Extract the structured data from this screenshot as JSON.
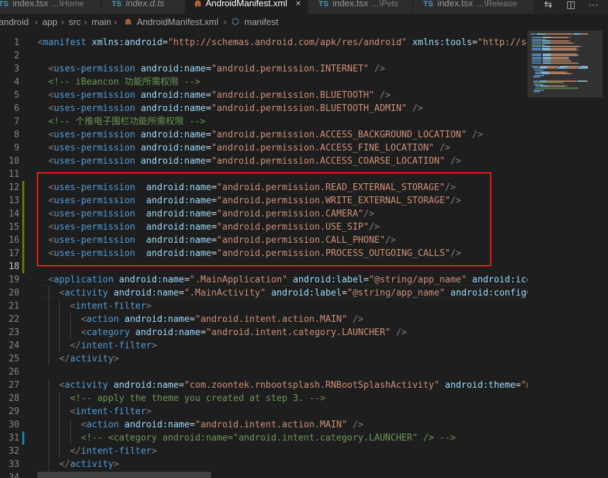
{
  "tabs": [
    {
      "name": "index.tsx",
      "desc": "...\\Home",
      "type": "ts",
      "italic": false,
      "active": false
    },
    {
      "name": "index.d.ts",
      "desc": "",
      "type": "ts",
      "italic": true,
      "active": false
    },
    {
      "name": "AndroidManifest.xml",
      "desc": "",
      "type": "xml",
      "italic": false,
      "active": true,
      "close": "×"
    },
    {
      "name": "index.tsx",
      "desc": "...\\Pets",
      "type": "ts",
      "italic": false,
      "active": false
    },
    {
      "name": "index.tsx",
      "desc": "...\\Release",
      "type": "ts",
      "italic": false,
      "active": false
    }
  ],
  "tab_actions": {
    "compare": "⇆",
    "split": "◫",
    "more": "···"
  },
  "breadcrumb": [
    "android",
    "app",
    "src",
    "main",
    "AndroidManifest.xml",
    "manifest"
  ],
  "ts_badge": "TS",
  "xml_badge": "⋒",
  "cube_icon": "⬡",
  "separator": "›",
  "colors": {
    "highlight_box": "#e51e1e",
    "added_line": "#587c0c",
    "modified_line": "#1b81a8"
  },
  "code_lines": [
    {
      "n": "1",
      "tokens": [
        [
          "<",
          "pn"
        ],
        [
          "manifest",
          "tg"
        ],
        [
          " xmlns:android",
          "at"
        ],
        [
          "=",
          "tx"
        ],
        [
          "\"http://schemas.android.com/apk/res/android\"",
          "st"
        ],
        [
          " xmlns:tools",
          "at"
        ],
        [
          "=",
          "tx"
        ],
        [
          "\"http://sch",
          "st"
        ]
      ]
    },
    {
      "n": "2",
      "tokens": []
    },
    {
      "n": "3",
      "tokens": [
        [
          "  <",
          "pn"
        ],
        [
          "uses-permission",
          "tg"
        ],
        [
          " android:name",
          "at"
        ],
        [
          "=",
          "tx"
        ],
        [
          "\"android.permission.INTERNET\"",
          "st"
        ],
        [
          " />",
          "pn"
        ]
      ]
    },
    {
      "n": "4",
      "tokens": [
        [
          "  <!-- iBeancon 功能所需权限 -->",
          "cm"
        ]
      ]
    },
    {
      "n": "5",
      "tokens": [
        [
          "  <",
          "pn"
        ],
        [
          "uses-permission",
          "tg"
        ],
        [
          " android:name",
          "at"
        ],
        [
          "=",
          "tx"
        ],
        [
          "\"android.permission.BLUETOOTH\"",
          "st"
        ],
        [
          " />",
          "pn"
        ]
      ]
    },
    {
      "n": "6",
      "tokens": [
        [
          "  <",
          "pn"
        ],
        [
          "uses-permission",
          "tg"
        ],
        [
          " android:name",
          "at"
        ],
        [
          "=",
          "tx"
        ],
        [
          "\"android.permission.BLUETOOTH_ADMIN\"",
          "st"
        ],
        [
          " />",
          "pn"
        ]
      ]
    },
    {
      "n": "7",
      "tokens": [
        [
          "  <!-- 个推电子围栏功能所需权限 -->",
          "cm"
        ]
      ]
    },
    {
      "n": "8",
      "tokens": [
        [
          "  <",
          "pn"
        ],
        [
          "uses-permission",
          "tg"
        ],
        [
          " android:name",
          "at"
        ],
        [
          "=",
          "tx"
        ],
        [
          "\"android.permission.ACCESS_BACKGROUND_LOCATION\"",
          "st"
        ],
        [
          " />",
          "pn"
        ]
      ]
    },
    {
      "n": "9",
      "tokens": [
        [
          "  <",
          "pn"
        ],
        [
          "uses-permission",
          "tg"
        ],
        [
          " android:name",
          "at"
        ],
        [
          "=",
          "tx"
        ],
        [
          "\"android.permission.ACCESS_FINE_LOCATION\"",
          "st"
        ],
        [
          " />",
          "pn"
        ]
      ]
    },
    {
      "n": "10",
      "tokens": [
        [
          "  <",
          "pn"
        ],
        [
          "uses-permission",
          "tg"
        ],
        [
          " android:name",
          "at"
        ],
        [
          "=",
          "tx"
        ],
        [
          "\"android.permission.ACCESS_COARSE_LOCATION\"",
          "st"
        ],
        [
          " />",
          "pn"
        ]
      ]
    },
    {
      "n": "11",
      "tokens": []
    },
    {
      "n": "12",
      "tokens": [
        [
          "  <",
          "pn"
        ],
        [
          "uses-permission",
          "tg"
        ],
        [
          "  android:name",
          "at"
        ],
        [
          "=",
          "tx"
        ],
        [
          "\"android.permission.READ_EXTERNAL_STORAGE\"",
          "st"
        ],
        [
          "/>",
          "pn"
        ]
      ]
    },
    {
      "n": "13",
      "tokens": [
        [
          "  <",
          "pn"
        ],
        [
          "uses-permission",
          "tg"
        ],
        [
          "  android:name",
          "at"
        ],
        [
          "=",
          "tx"
        ],
        [
          "\"android.permission.WRITE_EXTERNAL_STORAGE\"",
          "st"
        ],
        [
          "/>",
          "pn"
        ]
      ]
    },
    {
      "n": "14",
      "tokens": [
        [
          "  <",
          "pn"
        ],
        [
          "uses-permission",
          "tg"
        ],
        [
          "  android:name",
          "at"
        ],
        [
          "=",
          "tx"
        ],
        [
          "\"android.permission.CAMERA\"",
          "st"
        ],
        [
          "/>",
          "pn"
        ]
      ]
    },
    {
      "n": "15",
      "tokens": [
        [
          "  <",
          "pn"
        ],
        [
          "uses-permission",
          "tg"
        ],
        [
          "  android:name",
          "at"
        ],
        [
          "=",
          "tx"
        ],
        [
          "\"android.permission.USE_SIP\"",
          "st"
        ],
        [
          "/>",
          "pn"
        ]
      ]
    },
    {
      "n": "16",
      "tokens": [
        [
          "  <",
          "pn"
        ],
        [
          "uses-permission",
          "tg"
        ],
        [
          "  android:name",
          "at"
        ],
        [
          "=",
          "tx"
        ],
        [
          "\"android.permission.CALL_PHONE\"",
          "st"
        ],
        [
          "/>",
          "pn"
        ]
      ]
    },
    {
      "n": "17",
      "tokens": [
        [
          "  <",
          "pn"
        ],
        [
          "uses-permission",
          "tg"
        ],
        [
          "  android:name",
          "at"
        ],
        [
          "=",
          "tx"
        ],
        [
          "\"android.permission.PROCESS_OUTGOING_CALLS\"",
          "st"
        ],
        [
          "/>",
          "pn"
        ]
      ]
    },
    {
      "n": "18",
      "tokens": []
    },
    {
      "n": "19",
      "tokens": [
        [
          "  <",
          "pn"
        ],
        [
          "application",
          "tg"
        ],
        [
          " android:name",
          "at"
        ],
        [
          "=",
          "tx"
        ],
        [
          "\".MainApplication\"",
          "st"
        ],
        [
          " android:label",
          "at"
        ],
        [
          "=",
          "tx"
        ],
        [
          "\"@string/app_name\"",
          "st"
        ],
        [
          " android:icon",
          "at"
        ]
      ]
    },
    {
      "n": "20",
      "tokens": [
        [
          "    <",
          "pn"
        ],
        [
          "activity",
          "tg"
        ],
        [
          " android:name",
          "at"
        ],
        [
          "=",
          "tx"
        ],
        [
          "\".MainActivity\"",
          "st"
        ],
        [
          " android:label",
          "at"
        ],
        [
          "=",
          "tx"
        ],
        [
          "\"@string/app_name\"",
          "st"
        ],
        [
          " android:configCh",
          "at"
        ]
      ]
    },
    {
      "n": "21",
      "tokens": [
        [
          "      <",
          "pn"
        ],
        [
          "intent-filter",
          "tg"
        ],
        [
          ">",
          "pn"
        ]
      ]
    },
    {
      "n": "22",
      "tokens": [
        [
          "        <",
          "pn"
        ],
        [
          "action",
          "tg"
        ],
        [
          " android:name",
          "at"
        ],
        [
          "=",
          "tx"
        ],
        [
          "\"android.intent.action.MAIN\"",
          "st"
        ],
        [
          " />",
          "pn"
        ]
      ]
    },
    {
      "n": "23",
      "tokens": [
        [
          "        <",
          "pn"
        ],
        [
          "category",
          "tg"
        ],
        [
          " android:name",
          "at"
        ],
        [
          "=",
          "tx"
        ],
        [
          "\"android.intent.category.LAUNCHER\"",
          "st"
        ],
        [
          " />",
          "pn"
        ]
      ]
    },
    {
      "n": "24",
      "tokens": [
        [
          "      </",
          "pn"
        ],
        [
          "intent-filter",
          "tg"
        ],
        [
          ">",
          "pn"
        ]
      ]
    },
    {
      "n": "25",
      "tokens": [
        [
          "    </",
          "pn"
        ],
        [
          "activity",
          "tg"
        ],
        [
          ">",
          "pn"
        ]
      ]
    },
    {
      "n": "26",
      "tokens": []
    },
    {
      "n": "27",
      "tokens": [
        [
          "    <",
          "pn"
        ],
        [
          "activity",
          "tg"
        ],
        [
          " android:name",
          "at"
        ],
        [
          "=",
          "tx"
        ],
        [
          "\"com.zoontek.rnbootsplash.RNBootSplashActivity\"",
          "st"
        ],
        [
          " android:theme",
          "at"
        ],
        [
          "=",
          "tx"
        ],
        [
          "\"@s",
          "st"
        ]
      ]
    },
    {
      "n": "28",
      "tokens": [
        [
          "      <!-- apply the theme you created at step 3. -->",
          "cm"
        ]
      ]
    },
    {
      "n": "29",
      "tokens": [
        [
          "      <",
          "pn"
        ],
        [
          "intent-filter",
          "tg"
        ],
        [
          ">",
          "pn"
        ]
      ]
    },
    {
      "n": "30",
      "tokens": [
        [
          "        <",
          "pn"
        ],
        [
          "action",
          "tg"
        ],
        [
          " android:name",
          "at"
        ],
        [
          "=",
          "tx"
        ],
        [
          "\"android.intent.action.MAIN\"",
          "st"
        ],
        [
          " />",
          "pn"
        ]
      ]
    },
    {
      "n": "31",
      "tokens": [
        [
          "        <!-- <category android:name=\"android.intent.category.LAUNCHER\" /> -->",
          "cm"
        ]
      ]
    },
    {
      "n": "32",
      "tokens": [
        [
          "      </",
          "pn"
        ],
        [
          "intent-filter",
          "tg"
        ],
        [
          ">",
          "pn"
        ]
      ]
    },
    {
      "n": "33",
      "tokens": [
        [
          "    </",
          "pn"
        ],
        [
          "activity",
          "tg"
        ],
        [
          ">",
          "pn"
        ]
      ]
    },
    {
      "n": "34",
      "tokens": []
    }
  ],
  "current_line": "18",
  "added_lines": [
    "12",
    "13",
    "14",
    "15",
    "16",
    "17",
    "18"
  ],
  "modified_lines": [
    "31"
  ]
}
